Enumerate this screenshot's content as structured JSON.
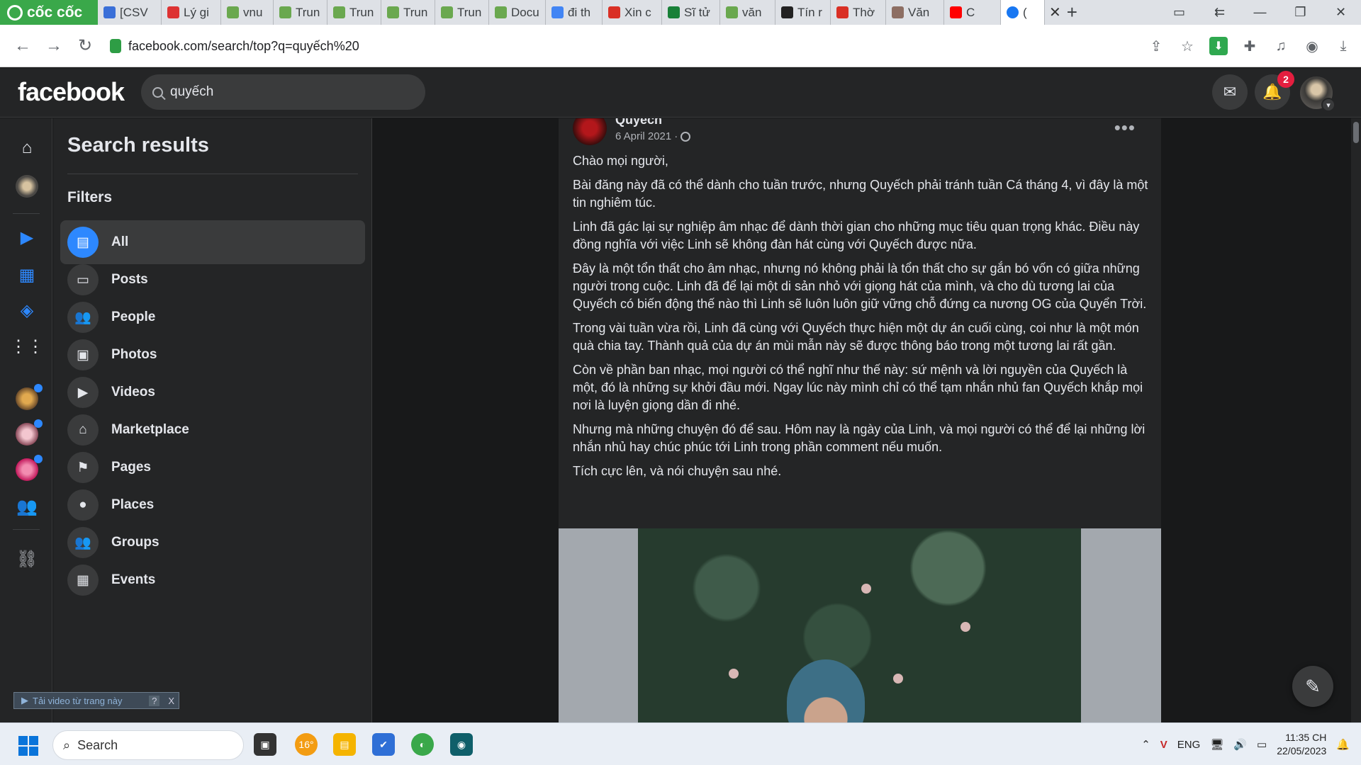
{
  "browser": {
    "brand": "cốc cốc",
    "tabs": [
      {
        "label": "[CSV",
        "color": "#3a6fd8"
      },
      {
        "label": "Lý gi",
        "color": "#d33"
      },
      {
        "label": "vnu",
        "color": "#6aa84f"
      },
      {
        "label": "Trun",
        "color": "#6aa84f"
      },
      {
        "label": "Trun",
        "color": "#6aa84f"
      },
      {
        "label": "Trun",
        "color": "#6aa84f"
      },
      {
        "label": "Trun",
        "color": "#6aa84f"
      },
      {
        "label": "Docu",
        "color": "#6aa84f"
      },
      {
        "label": "đi th",
        "color": "#4285f4"
      },
      {
        "label": "Xin c",
        "color": "#d93025"
      },
      {
        "label": "Sĩ tử",
        "color": "#188038"
      },
      {
        "label": "văn",
        "color": "#6aa84f"
      },
      {
        "label": "Tín r",
        "color": "#222"
      },
      {
        "label": "Thờ",
        "color": "#d93025"
      },
      {
        "label": "Văn",
        "color": "#8d6e63"
      },
      {
        "label": "C",
        "color": "#ff0000"
      }
    ],
    "active_tab": {
      "label": "(",
      "color": "#1877f2"
    },
    "url": "facebook.com/search/top?q=quyếch%20"
  },
  "facebook": {
    "logo": "facebook",
    "search_value": "quyếch",
    "notification_count": "2"
  },
  "sidebar": {
    "title": "Search results",
    "filters_label": "Filters",
    "filters": [
      {
        "label": "All",
        "icon": "all-results-icon",
        "active": true
      },
      {
        "label": "Posts",
        "icon": "posts-icon"
      },
      {
        "label": "People",
        "icon": "people-icon"
      },
      {
        "label": "Photos",
        "icon": "photos-icon"
      },
      {
        "label": "Videos",
        "icon": "videos-icon"
      },
      {
        "label": "Marketplace",
        "icon": "marketplace-icon"
      },
      {
        "label": "Pages",
        "icon": "pages-icon"
      },
      {
        "label": "Places",
        "icon": "places-icon"
      },
      {
        "label": "Groups",
        "icon": "groups-icon"
      },
      {
        "label": "Events",
        "icon": "events-icon"
      }
    ],
    "video_download_bar": "Tải video từ trang này",
    "video_download_help": "?",
    "video_download_close": "X"
  },
  "post": {
    "author": "Quyech",
    "date": "6 April 2021",
    "paragraphs": [
      "Chào mọi người,",
      "Bài đăng này đã có thể dành cho tuần trước, nhưng Quyếch phải tránh tuần Cá tháng 4, vì đây là một tin nghiêm túc.",
      "Linh đã gác lại sự nghiệp âm nhạc để dành thời gian cho những mục tiêu quan trọng khác. Điều này đồng nghĩa với việc Linh sẽ không đàn hát cùng với Quyếch được nữa.",
      "Đây là một tổn thất cho âm nhạc, nhưng nó không phải là tổn thất cho sự gắn bó vốn có giữa những người trong cuộc. Linh đã để lại một di sản nhỏ với giọng hát của mình, và cho dù tương lai của Quyếch có biến động thế nào thì Linh sẽ luôn luôn giữ vững chỗ đứng ca nương OG của Quyển Trời.",
      "Trong vài tuần vừa rồi, Linh đã cùng với Quyếch thực hiện một dự án cuối cùng, coi như là một món quà chia tay. Thành quả của dự án mùi mẫn này sẽ được thông báo trong một tương lai rất gần.",
      "Còn về phần ban nhạc, mọi người có thể nghĩ như thế này: sứ mệnh và lời nguyền của Quyếch là một, đó là những sự khởi đầu mới. Ngay lúc này mình chỉ có thể tạm nhắn nhủ fan Quyếch khắp mọi nơi là luyện giọng dần đi nhé.",
      "Nhưng mà những chuyện đó để sau. Hôm nay là ngày của Linh, và mọi người có thể để lại những lời nhắn nhủ hay chúc phúc tới Linh trong phần comment nếu muốn.",
      "Tích cực lên, và nói chuyện sau nhé."
    ]
  },
  "taskbar": {
    "search_label": "Search",
    "weather_temp": "16°",
    "language": "ENG",
    "time": "11:35 CH",
    "date": "22/05/2023"
  }
}
